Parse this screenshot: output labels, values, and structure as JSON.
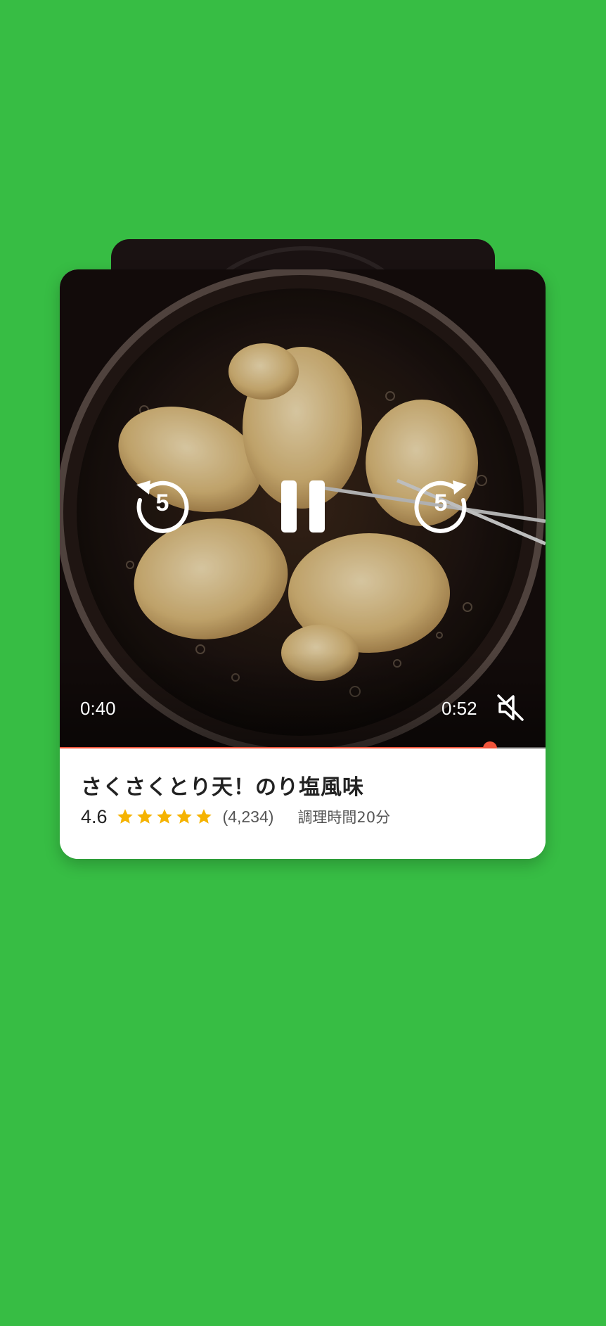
{
  "player": {
    "current_time": "0:40",
    "total_time": "0:52",
    "progress_fraction": 0.885,
    "skip_seconds_label": "5",
    "muted": true,
    "controls": {
      "skip_back_icon": "replay-5-icon",
      "pause_icon": "pause-icon",
      "skip_forward_icon": "forward-5-icon",
      "mute_icon": "volume-off-icon"
    }
  },
  "recipe": {
    "title": "さくさくとり天！のり塩風味",
    "rating": "4.6",
    "stars": 5,
    "review_count": "(4,234)",
    "cook_time": "調理時間20分"
  },
  "colors": {
    "background": "#37bd44",
    "accent": "#f0543b",
    "star": "#f5b301"
  }
}
